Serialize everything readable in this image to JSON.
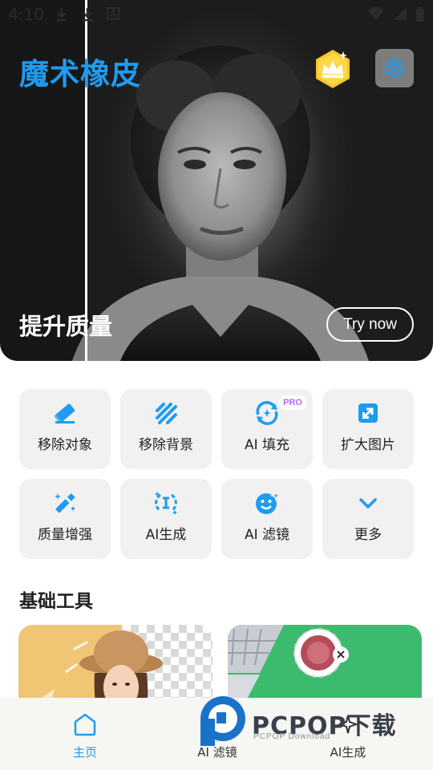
{
  "status_bar": {
    "time": "4:10"
  },
  "header": {
    "app_title": "魔术橡皮"
  },
  "hero": {
    "caption": "提升质量",
    "try_now": "Try now"
  },
  "tools": [
    {
      "label": "移除对象",
      "icon": "eraser-icon"
    },
    {
      "label": "移除背景",
      "icon": "stripes-icon"
    },
    {
      "label": "AI 填充",
      "icon": "ai-fill-icon",
      "badge": "PRO"
    },
    {
      "label": "扩大图片",
      "icon": "expand-image-icon"
    },
    {
      "label": "质量增强",
      "icon": "magic-wand-icon"
    },
    {
      "label": "AI生成",
      "icon": "ai-generate-icon"
    },
    {
      "label": "AI 滤镜",
      "icon": "face-filter-icon"
    },
    {
      "label": "更多",
      "icon": "chevron-down-icon"
    }
  ],
  "basic_tools": {
    "title": "基础工具"
  },
  "bottom_nav": [
    {
      "label": "主页",
      "icon": "home-icon",
      "active": true
    },
    {
      "label": "AI 滤镜",
      "icon": "filter-icon",
      "active": false
    },
    {
      "label": "AI生成",
      "icon": "sparkle-icon",
      "active": false
    }
  ],
  "watermark": {
    "brand": "PCPOP下载",
    "sub": "PCPOP Download"
  },
  "colors": {
    "accent": "#1f9bf0",
    "pro": "#b56cf0",
    "tile_bg": "#f1f1f1"
  }
}
